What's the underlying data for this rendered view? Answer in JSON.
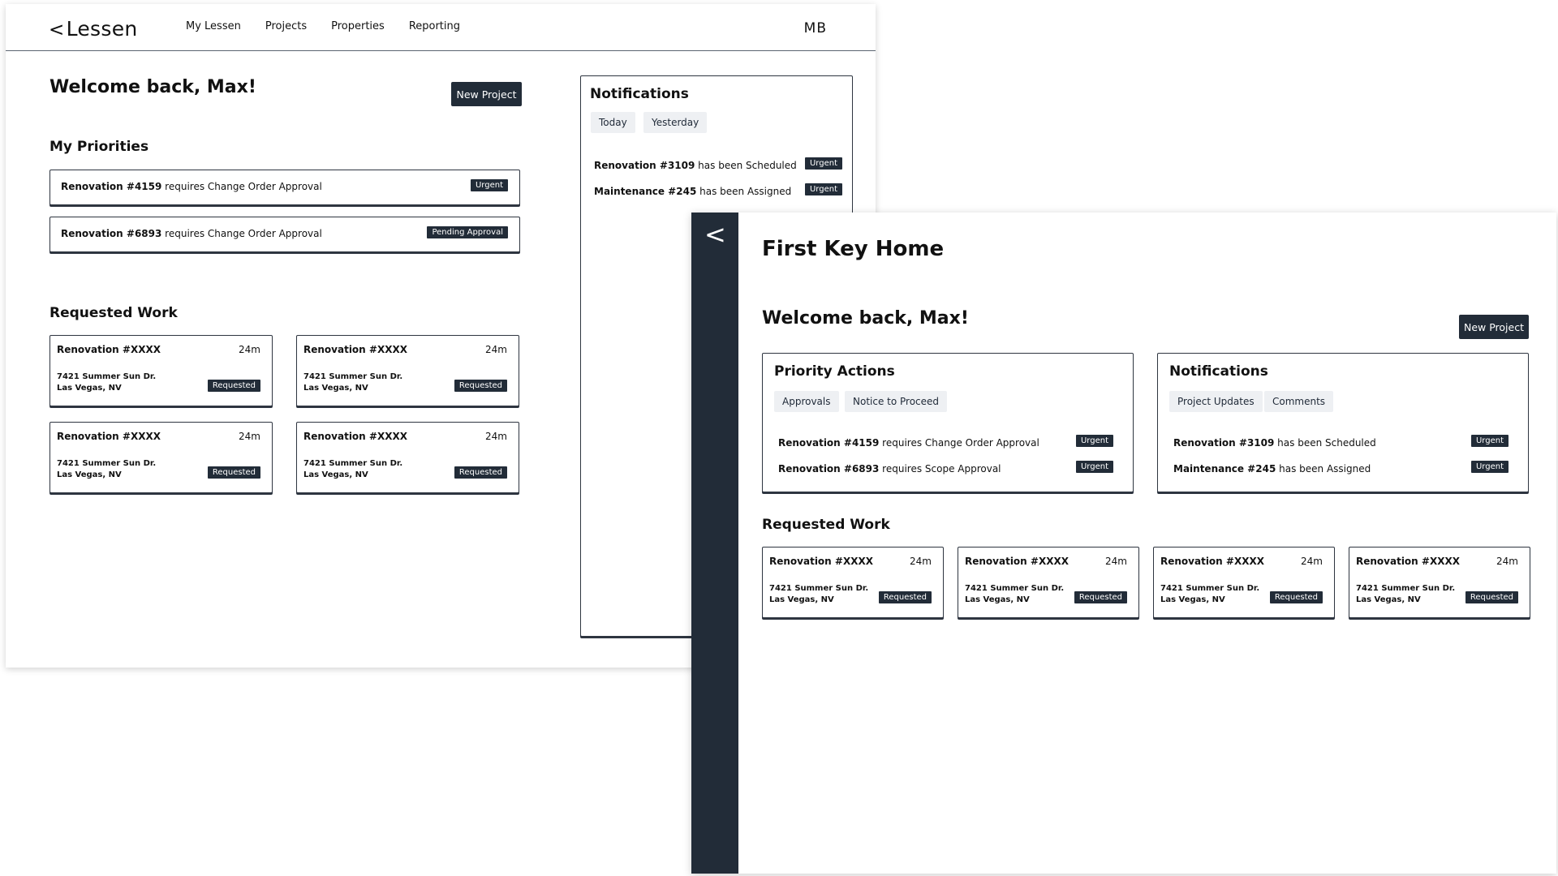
{
  "colors": {
    "dark": "#222c38",
    "chip_bg": "#eef0f3",
    "border": "#2e3540"
  },
  "win1": {
    "logo_icon": "chevron-left-icon",
    "logo_text": "Lessen",
    "nav": [
      "My Lessen",
      "Projects",
      "Properties",
      "Reporting"
    ],
    "initials": "MB",
    "welcome": "Welcome back, Max!",
    "new_project": "New Project",
    "priorities_title": "My Priorities",
    "priorities": [
      {
        "bold": "Renovation #4159",
        "text": " requires Change Order Approval",
        "badge": "Urgent"
      },
      {
        "bold": "Renovation #6893",
        "text": " requires Change Order Approval",
        "badge": "Pending Approval"
      }
    ],
    "requested_title": "Requested Work",
    "cards": [
      {
        "title": "Renovation #XXXX",
        "time": "24m",
        "addr1": "7421 Summer Sun Dr.",
        "addr2": "Las Vegas, NV",
        "badge": "Requested"
      },
      {
        "title": "Renovation #XXXX",
        "time": "24m",
        "addr1": "7421 Summer Sun Dr.",
        "addr2": "Las Vegas, NV",
        "badge": "Requested"
      },
      {
        "title": "Renovation #XXXX",
        "time": "24m",
        "addr1": "7421 Summer Sun Dr.",
        "addr2": "Las Vegas, NV",
        "badge": "Requested"
      },
      {
        "title": "Renovation #XXXX",
        "time": "24m",
        "addr1": "7421 Summer Sun Dr.",
        "addr2": "Las Vegas, NV",
        "badge": "Requested"
      }
    ],
    "notifications": {
      "title": "Notifications",
      "tabs": [
        "Today",
        "Yesterday"
      ],
      "items": [
        {
          "bold": "Renovation #3109",
          "text": " has been Scheduled",
          "badge": "Urgent"
        },
        {
          "bold": "Maintenance #245",
          "text": " has been Assigned",
          "badge": "Urgent"
        }
      ]
    }
  },
  "win2": {
    "sidebar_icon": "chevron-left-icon",
    "title": "First Key Home",
    "welcome": "Welcome back, Max!",
    "new_project": "New Project",
    "priority": {
      "title": "Priority Actions",
      "tabs": [
        "Approvals",
        "Notice to Proceed"
      ],
      "items": [
        {
          "bold": "Renovation #4159",
          "text": " requires Change Order Approval",
          "badge": "Urgent"
        },
        {
          "bold": "Renovation #6893",
          "text": " requires Scope Approval",
          "badge": "Urgent"
        }
      ]
    },
    "notifications": {
      "title": "Notifications",
      "tabs": [
        "Project Updates",
        "Comments"
      ],
      "items": [
        {
          "bold": "Renovation #3109",
          "text": " has been Scheduled",
          "badge": "Urgent"
        },
        {
          "bold": "Maintenance #245",
          "text": " has been Assigned",
          "badge": "Urgent"
        }
      ]
    },
    "requested_title": "Requested Work",
    "cards": [
      {
        "title": "Renovation #XXXX",
        "time": "24m",
        "addr1": "7421 Summer Sun Dr.",
        "addr2": "Las Vegas, NV",
        "badge": "Requested"
      },
      {
        "title": "Renovation #XXXX",
        "time": "24m",
        "addr1": "7421 Summer Sun Dr.",
        "addr2": "Las Vegas, NV",
        "badge": "Requested"
      },
      {
        "title": "Renovation #XXXX",
        "time": "24m",
        "addr1": "7421 Summer Sun Dr.",
        "addr2": "Las Vegas, NV",
        "badge": "Requested"
      },
      {
        "title": "Renovation #XXXX",
        "time": "24m",
        "addr1": "7421 Summer Sun Dr.",
        "addr2": "Las Vegas, NV",
        "badge": "Requested"
      }
    ]
  }
}
